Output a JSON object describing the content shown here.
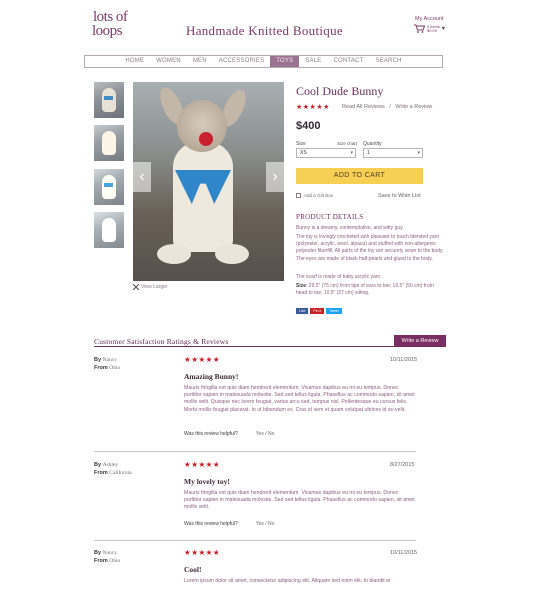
{
  "header": {
    "logo_line1": "lots of",
    "logo_line2": "loops",
    "tagline": "Handmade Knitted Boutique",
    "account_label": "My Account",
    "cart_count": "0 items",
    "cart_total": "$0.00"
  },
  "nav": {
    "items": [
      "HOME",
      "WOMEN",
      "MEN",
      "ACCESSORIES",
      "TOYS",
      "SALE",
      "CONTACT",
      "SEARCH"
    ],
    "active": "TOYS"
  },
  "gallery": {
    "view_larger": "View Larger"
  },
  "product": {
    "title": "Cool Dude Bunny",
    "stars": "★★★★★",
    "read_all_reviews": "Read All Reviews",
    "separator": "/",
    "write_review_link": "Write a Review",
    "price": "$400",
    "size_label": "Size",
    "size_chart": "Size chart",
    "size_value": "XS",
    "quantity_label": "Quantity",
    "quantity_value": "1",
    "add_to_cart": "ADD TO CART",
    "gift_box": "Add a Gift Box",
    "wishlist": "Save to Wish List",
    "details_heading": "PRODUCT DETAILS",
    "details_p1": "Bunny is a dreamy, contemplative, and witty guy.",
    "details_p2": "The toy is lovingly crocheted with pleasant to touch blended yarn (polyester, acrylic, wool, alpaca) and stuffed with non-allergenic polyester fiberfill. All parts of the toy are securely sewn to the body. The eyes are made of black half-pearls and glued to the body.",
    "details_p3": "The scarf is made of baby acrylic yarn.",
    "details_size_label": "Size",
    "details_size_text": ": 29.5\" (75 cm) from tips of ears to toe; 19.5\" (50 cm) from head to toe; 10.5\" (27 cm) sitting.",
    "share": [
      "Like",
      "Pin it",
      "Tweet"
    ]
  },
  "reviews": {
    "heading": "Customer Satisfaction Ratings & Reviews",
    "write_button": "Write a Review",
    "by_label": "By",
    "from_label": "From",
    "helpful_label": "Was this review helpful?",
    "yes_no": "Yes / No",
    "items": [
      {
        "name": "Nancy",
        "from": "Ohio",
        "stars": "★★★★★",
        "date": "10/11/2015",
        "headline": "Amazing Bunny!",
        "body": "Mauris fringilla est quis diam hendrerit elementum. Vivamus dapibus eu mi eu tempus. Donec porttitor sapien in malesuada molestie. Sed sed tellus ligula. Phasellus ac commodo sapien, sit amet mollis velit. Quisque nec lorem feugiat, varius arcu sed, tempus nisl. Pellentesque eu cursus felis. Morbi mollis feugiat placerat. In ut bibendum ex. Cras id sem et quam volutpat ultrices id eu velit."
      },
      {
        "name": "Ashley",
        "from": "California",
        "stars": "★★★★★",
        "date": "8/27/2015",
        "headline": "My lovely toy!",
        "body": "Mauris fringilla est quis diam hendrerit elementum. Vivamus dapibus eu mi eu tempus. Donec porttitor sapien in malesuada molestie. Sed sed tellus ligula. Phasellus ac commodo sapien, sit amet mollis velit."
      },
      {
        "name": "Nancy",
        "from": "Ohio",
        "stars": "★★★★★",
        "date": "10/11/2015",
        "headline": "Cool!",
        "body": "Lorem ipsum dolor sit amet, consectetur adipiscing elit. Aliquam sed enim elit. In blandit et"
      }
    ]
  }
}
